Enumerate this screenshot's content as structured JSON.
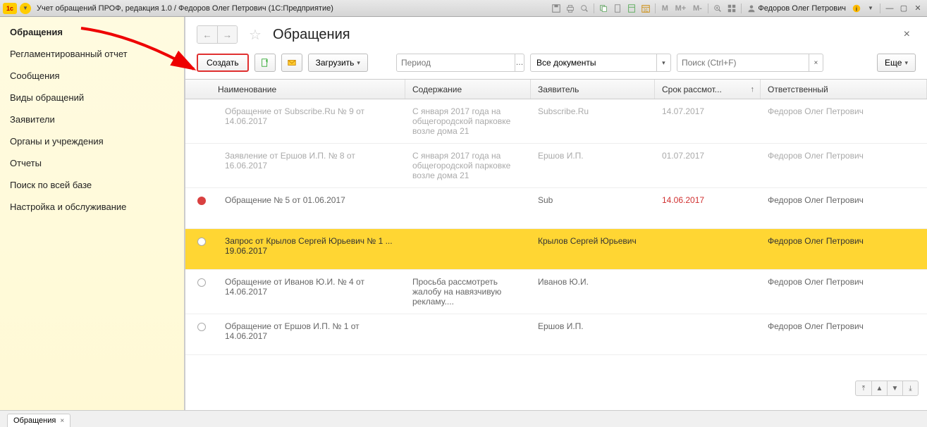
{
  "titlebar": {
    "title": "Учет обращений ПРОФ, редакция 1.0 / Федоров Олег Петрович  (1С:Предприятие)",
    "user": "Федоров Олег Петрович",
    "m_btns": [
      "M",
      "M+",
      "M-"
    ]
  },
  "sidebar": {
    "items": [
      {
        "label": "Обращения",
        "active": true
      },
      {
        "label": "Регламентированный отчет"
      },
      {
        "label": "Сообщения"
      },
      {
        "label": "Виды обращений"
      },
      {
        "label": "Заявители"
      },
      {
        "label": "Органы и учреждения"
      },
      {
        "label": "Отчеты"
      },
      {
        "label": "Поиск по всей базе"
      },
      {
        "label": "Настройка и обслуживание"
      }
    ]
  },
  "page": {
    "title": "Обращения"
  },
  "toolbar": {
    "create": "Создать",
    "load": "Загрузить",
    "period_ph": "Период",
    "filter": "Все документы",
    "search_ph": "Поиск (Ctrl+F)",
    "more": "Еще"
  },
  "columns": {
    "name": "Наименование",
    "content": "Содержание",
    "applicant": "Заявитель",
    "due": "Срок рассмот...",
    "responsible": "Ответственный"
  },
  "rows": [
    {
      "status": "",
      "name": "Обращение от Subscribe.Ru № 9 от 14.06.2017",
      "content": "С января 2017 года на общегородской парковке возле дома 21",
      "applicant": "Subscribe.Ru",
      "due": "14.07.2017",
      "responsible": "Федоров Олег Петрович",
      "dim": true
    },
    {
      "status": "",
      "name": "Заявление от Ершов И.П. № 8 от 16.06.2017",
      "content": "С января 2017 года на общегородской парковке возле дома 21",
      "applicant": "Ершов И.П.",
      "due": "01.07.2017",
      "responsible": "Федоров Олег Петрович",
      "dim": true
    },
    {
      "status": "red",
      "name": "Обращение № 5 от  01.06.2017",
      "content": "",
      "applicant": "Sub",
      "due": "14.06.2017",
      "responsible": "Федоров Олег Петрович",
      "overdue": true
    },
    {
      "status": "empty",
      "name": "Запрос от Крылов Сергей Юрьевич № 1 ... 19.06.2017",
      "content": "",
      "applicant": "Крылов Сергей Юрьевич",
      "due": "",
      "responsible": "Федоров Олег Петрович",
      "selected": true
    },
    {
      "status": "empty",
      "name": "Обращение от Иванов Ю.И. № 4 от 14.06.2017",
      "content": "Просьба рассмотреть жалобу на навязчивую рекламу....",
      "applicant": "Иванов Ю.И.",
      "due": "",
      "responsible": "Федоров Олег Петрович"
    },
    {
      "status": "empty",
      "name": "Обращение от Ершов И.П. № 1 от 14.06.2017",
      "content": "",
      "applicant": "Ершов И.П.",
      "due": "",
      "responsible": "Федоров Олег Петрович"
    }
  ],
  "bottom_tab": {
    "label": "Обращения"
  }
}
